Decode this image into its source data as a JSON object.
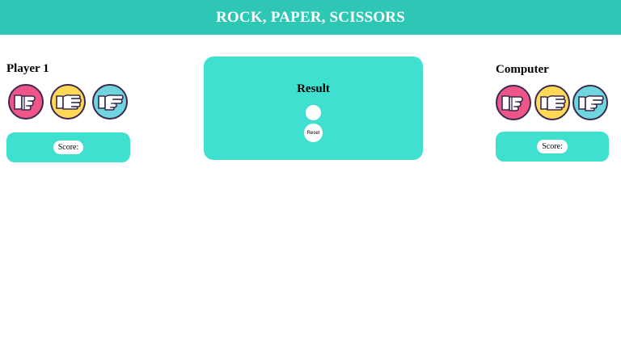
{
  "header": {
    "title": "ROCK, PAPER, SCISSORS"
  },
  "player": {
    "name": "Player 1",
    "score_label": "Score:",
    "choices": [
      {
        "icon": "rock-hand-icon",
        "color": "#f0558a"
      },
      {
        "icon": "paper-hand-icon",
        "color": "#ffd856"
      },
      {
        "icon": "scissors-hand-icon",
        "color": "#6fd6df"
      }
    ]
  },
  "computer": {
    "name": "Computer",
    "score_label": "Score:",
    "choices": [
      {
        "icon": "rock-hand-icon",
        "color": "#f0558a"
      },
      {
        "icon": "paper-hand-icon",
        "color": "#ffd856"
      },
      {
        "icon": "scissors-hand-icon",
        "color": "#6fd6df"
      }
    ]
  },
  "result": {
    "title": "Result",
    "reset_label": "Reset"
  },
  "colors": {
    "header": "#2ec7b6",
    "panel": "#40e0d0",
    "outline": "#3a2a4f"
  }
}
